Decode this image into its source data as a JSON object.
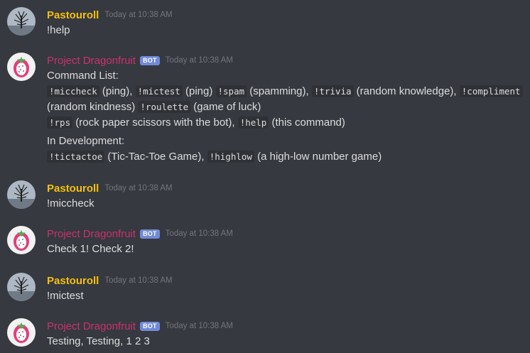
{
  "users": {
    "human": {
      "name": "Pastouroll",
      "color": "#f4c00e",
      "avatar": "tree-avatar-icon"
    },
    "bot": {
      "name": "Project Dragonfruit",
      "color": "#c8326e",
      "tag": "BOT",
      "avatar": "dragonfruit-avatar-icon"
    }
  },
  "messages": [
    {
      "author": "Pastouroll",
      "timestamp": "Today at 10:38 AM",
      "text": "!help"
    },
    {
      "author": "Project Dragonfruit",
      "bot_tag": "BOT",
      "timestamp": "Today at 10:38 AM",
      "command_list_title": "Command List:",
      "l2": {
        "c1": "!miccheck",
        "t1": " (ping), ",
        "c2": "!mictest",
        "t2": " (ping) ",
        "c3": "!spam",
        "t3": " (spamming), ",
        "c4": "!trivia",
        "t4": " (random knowledge), ",
        "c5": "!compliment"
      },
      "l3": {
        "t0": "(random kindness) ",
        "c1": "!roulette",
        "t1": " (game of luck)"
      },
      "l4": {
        "c1": "!rps",
        "t1": " (rock paper scissors with the bot), ",
        "c2": "!help",
        "t2": " (this command)"
      },
      "dev_title": "In Development:",
      "l5": {
        "c1": "!tictactoe",
        "t1": " (Tic-Tac-Toe Game), ",
        "c2": "!highlow",
        "t2": " (a high-low number game)"
      }
    },
    {
      "author": "Pastouroll",
      "timestamp": "Today at 10:38 AM",
      "text": "!miccheck"
    },
    {
      "author": "Project Dragonfruit",
      "bot_tag": "BOT",
      "timestamp": "Today at 10:38 AM",
      "text": "Check 1! Check 2!"
    },
    {
      "author": "Pastouroll",
      "timestamp": "Today at 10:38 AM",
      "text": "!mictest"
    },
    {
      "author": "Project Dragonfruit",
      "bot_tag": "BOT",
      "timestamp": "Today at 10:38 AM",
      "text": "Testing, Testing, 1 2 3"
    }
  ]
}
